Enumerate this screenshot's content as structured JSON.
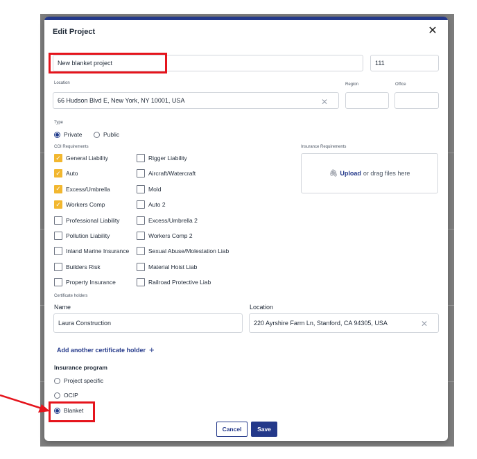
{
  "modal": {
    "title": "Edit Project",
    "close_icon": "close-icon"
  },
  "project": {
    "name_value": "New blanket project",
    "number_value": "111",
    "location_label": "Location",
    "location_value": "66 Hudson Blvd E, New York, NY 10001, USA",
    "region_label": "Region",
    "region_value": "",
    "office_label": "Office",
    "office_value": ""
  },
  "type": {
    "label": "Type",
    "options": [
      {
        "label": "Private",
        "selected": true
      },
      {
        "label": "Public",
        "selected": false
      }
    ]
  },
  "coi": {
    "label": "COI Requirements",
    "col1": [
      {
        "label": "General Liability",
        "checked": true
      },
      {
        "label": "Auto",
        "checked": true
      },
      {
        "label": "Excess/Umbrella",
        "checked": true
      },
      {
        "label": "Workers Comp",
        "checked": true
      },
      {
        "label": "Professional Liability",
        "checked": false
      },
      {
        "label": "Pollution Liability",
        "checked": false
      },
      {
        "label": "Inland Marine Insurance",
        "checked": false
      },
      {
        "label": "Builders Risk",
        "checked": false
      },
      {
        "label": "Property Insurance",
        "checked": false
      }
    ],
    "col2": [
      {
        "label": "Rigger Liability",
        "checked": false
      },
      {
        "label": "Aircraft/Watercraft",
        "checked": false
      },
      {
        "label": "Mold",
        "checked": false
      },
      {
        "label": "Auto 2",
        "checked": false
      },
      {
        "label": "Excess/Umbrella 2",
        "checked": false
      },
      {
        "label": "Workers Comp 2",
        "checked": false
      },
      {
        "label": "Sexual Abuse/Molestation Liab",
        "checked": false
      },
      {
        "label": "Material Hoist Liab",
        "checked": false
      },
      {
        "label": "Railroad Protective Liab",
        "checked": false
      }
    ]
  },
  "insurance_requirements": {
    "label": "Insurance Requirements",
    "upload_link": "Upload",
    "drop_text": "or drag files here"
  },
  "certificate_holders": {
    "label": "Certificate holders",
    "name_label": "Name",
    "name_value": "Laura Construction",
    "location_label": "Location",
    "location_value": "220 Ayrshire Farm Ln, Stanford, CA 94305, USA",
    "add_link": "Add another certificate holder"
  },
  "insurance_program": {
    "label": "Insurance program",
    "options": [
      {
        "label": "Project specific",
        "selected": false
      },
      {
        "label": "OCIP",
        "selected": false
      },
      {
        "label": "Blanket",
        "selected": true
      }
    ]
  },
  "footer": {
    "cancel_label": "Cancel",
    "save_label": "Save"
  },
  "colors": {
    "accent": "#24398a",
    "checkbox_checked": "#f2b72f",
    "highlight": "#e5141c"
  }
}
